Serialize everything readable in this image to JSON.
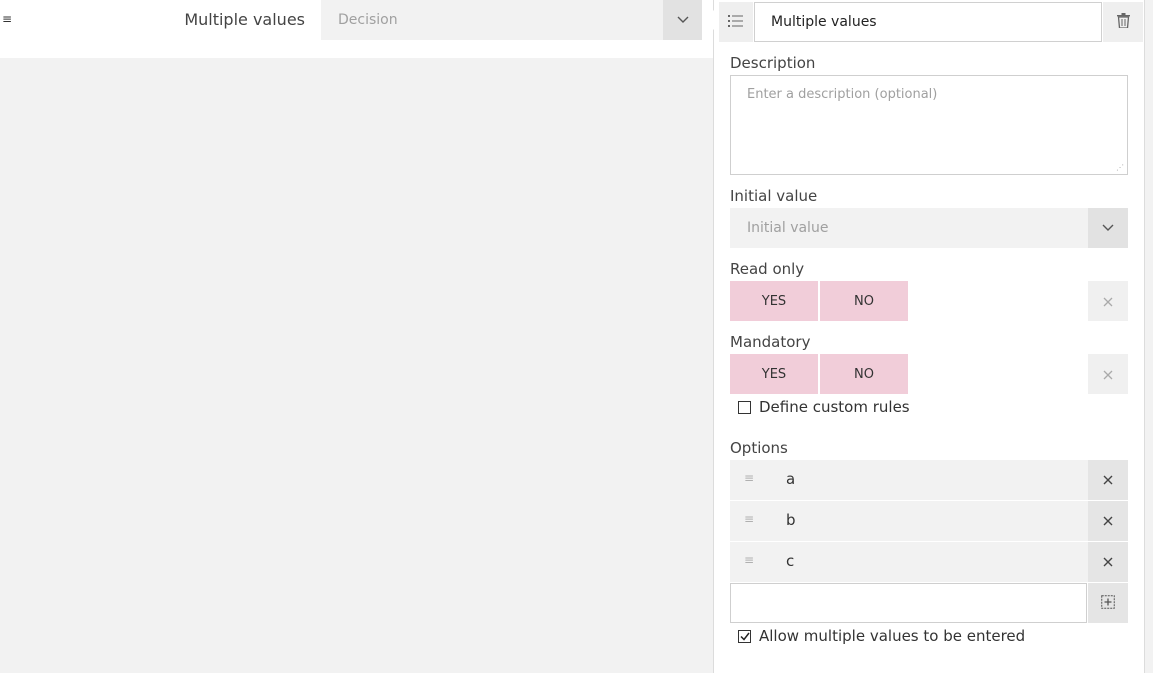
{
  "form": {
    "menu_icon": "≡",
    "field_label": "Multiple values",
    "field_placeholder": "Decision"
  },
  "panel": {
    "name_value": "Multiple values",
    "description_label": "Description",
    "description_placeholder": "Enter a description (optional)",
    "initial_value_label": "Initial value",
    "initial_value_placeholder": "Initial value",
    "read_only": {
      "label": "Read only",
      "yes": "YES",
      "no": "NO"
    },
    "mandatory": {
      "label": "Mandatory",
      "yes": "YES",
      "no": "NO"
    },
    "custom_rules_label": "Define custom rules",
    "options_label": "Options",
    "options": [
      "a",
      "b",
      "c"
    ],
    "new_option_value": "",
    "allow_multiple_label": "Allow multiple values to be entered"
  },
  "icons": {
    "type": "list-icon",
    "delete": "trash-icon",
    "dropdown": "chevron-down-icon",
    "clear": "close-icon",
    "drag": "drag-handle-icon",
    "add": "add-box-icon"
  },
  "colors": {
    "toggle_bg": "#f1cdd9",
    "panel_bg": "#ffffff",
    "page_bg": "#f2f2f2"
  }
}
